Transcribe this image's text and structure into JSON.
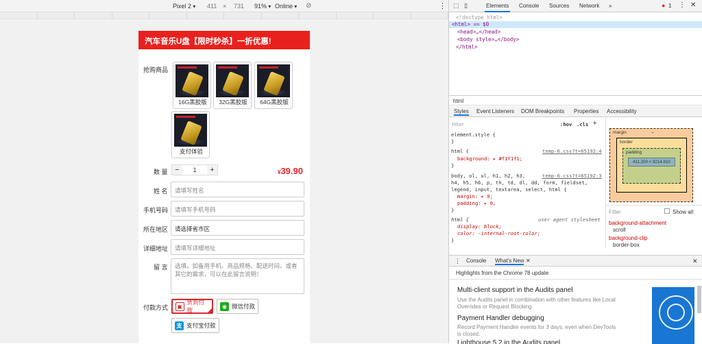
{
  "device_toolbar": {
    "device": "Pixel 2",
    "width": "411",
    "times": "×",
    "height": "731",
    "zoom": "91%",
    "network": "Online"
  },
  "page": {
    "banner": "汽车音乐U盘【限时秒杀】一折优惠!",
    "product_label": "抢购商品",
    "products": [
      {
        "caption": "16G黑胶版"
      },
      {
        "caption": "32G黑胶版"
      },
      {
        "caption": "64G黑胶版"
      },
      {
        "caption": "支付体验"
      }
    ],
    "qty_label": "数 量",
    "qty_minus": "−",
    "qty_value": "1",
    "qty_plus": "+",
    "price_symbol": "¥",
    "price": "39.90",
    "fields": [
      {
        "label": "姓 名",
        "placeholder": "请填写姓名"
      },
      {
        "label": "手机号码",
        "placeholder": "请填写手机号码"
      },
      {
        "label": "所在地区",
        "placeholder": "请选择省市区"
      },
      {
        "label": "详细地址",
        "placeholder": "请填写详细地址"
      }
    ],
    "message_label": "留 言",
    "message_placeholder": "选填，如备用手机、商品规格、配送时间、或者其它的需求，可以在此留言说明！",
    "payment_label": "付款方式",
    "payments": [
      {
        "label": "货到付款",
        "color": "#d8272d"
      },
      {
        "label": "微信付款",
        "color": "#1aad19"
      },
      {
        "label": "支付宝付款",
        "color": "#1296db"
      }
    ]
  },
  "devtools": {
    "tabs": [
      "Elements",
      "Console",
      "Sources",
      "Network",
      "»"
    ],
    "error_count": "1",
    "dom": [
      "<!doctype html>",
      "<html> == $0",
      "<head>…</head>",
      "<body style>…</body>",
      "</html>"
    ],
    "breadcrumb": "html",
    "subtabs": [
      "Styles",
      "Event Listeners",
      "DOM Breakpoints",
      "Properties",
      "Accessibility"
    ],
    "filter_placeholder": "Filter",
    "hov": ":hov",
    "cls": ".cls",
    "rules": {
      "r1": "element.style {",
      "r1c": "}",
      "r2": "html {",
      "r2src": "temp-6.css?t=65192:4",
      "r2p": "background: ▸ #f1f1f1;",
      "r2c": "}",
      "r3a": "body, ol, ul, h1, h2, h3,",
      "r3src": "temp-6.css?t=65192:3",
      "r3b": "h4, h5, h6, p, th, td, dl, dd, form, fieldset,",
      "r3c": "legend, input, textarea, select, html {",
      "r3p1": "margin: ▸ 0;",
      "r3p2": "padding: ▸ 0;",
      "r3e": "}",
      "r4": "html {",
      "r4src": "user agent stylesheet",
      "r4p1": "display: block;",
      "r4p2": "color: -internal-root-color;",
      "r4e": "}"
    },
    "boxmodel": {
      "margin": "margin",
      "border": "border",
      "padding": "padding",
      "dash": "–",
      "size": "411.200 × 9214.810"
    },
    "computed_filter": "Filter",
    "show_all": "Show all",
    "computed": [
      {
        "prop": "background-attachment",
        "val": "scroll"
      },
      {
        "prop": "background-clip",
        "val": "border-box"
      },
      {
        "prop": "background-color",
        "val": ""
      }
    ],
    "drawer_tabs": [
      "Console",
      "What's New"
    ],
    "drawer_title": "Highlights from the Chrome 78 update",
    "news": [
      {
        "title": "Multi-client support in the Audits panel",
        "desc": "Use the Audits panel in combination with other features like Local Overrides or Request Blocking."
      },
      {
        "title": "Payment Handler debugging",
        "desc": "Record Payment Handler events for 3 days, even when DevTools is closed."
      },
      {
        "title": "Lighthouse 5.2 in the Audits panel",
        "desc": ""
      }
    ]
  }
}
